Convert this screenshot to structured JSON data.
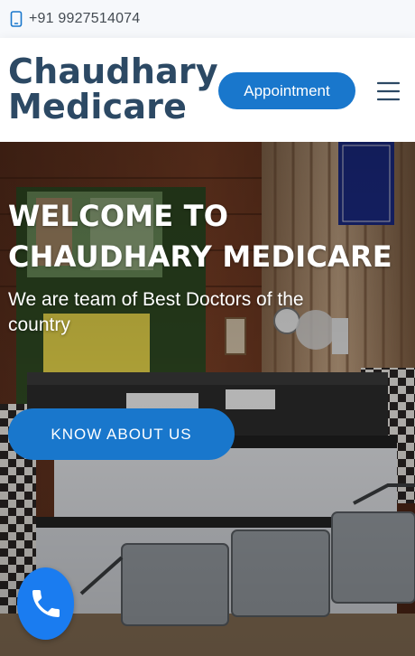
{
  "topbar": {
    "phone_icon": "phone-icon",
    "phone": "+91 9927514074"
  },
  "header": {
    "logo_line1": "Chaudhary",
    "logo_line2": "Medicare",
    "appointment_label": "Appointment",
    "menu_icon": "hamburger-menu-icon"
  },
  "hero": {
    "title_line1": "WELCOME TO",
    "title_line2": "CHAUDHARY MEDICARE",
    "subtitle": "We are team of Best Doctors of the country",
    "cta_label": "KNOW ABOUT US"
  },
  "fab": {
    "icon": "phone-call-icon"
  },
  "colors": {
    "brand_dark": "#2c4964",
    "accent": "#1977cc",
    "fab": "#1a7cf0",
    "topbar_bg": "#f6f8fb"
  }
}
